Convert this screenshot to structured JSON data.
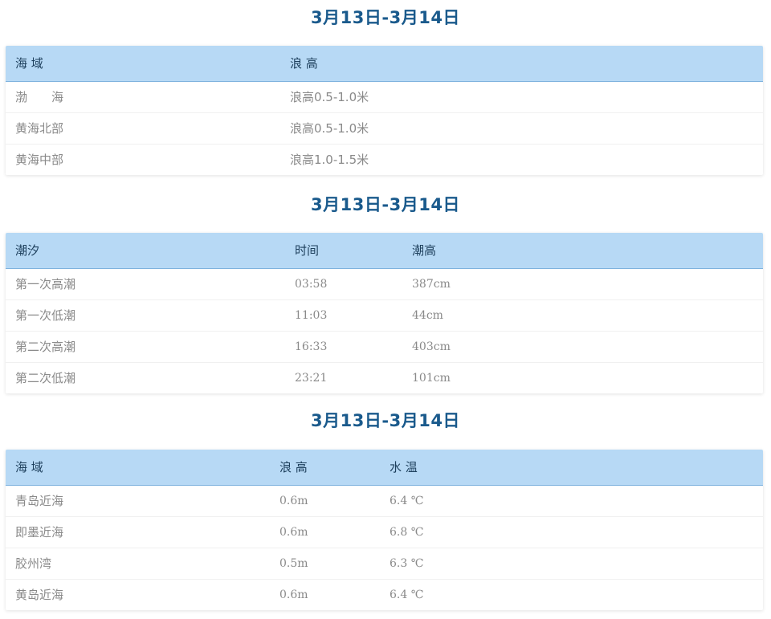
{
  "sections": [
    {
      "title": "3月13日-3月14日",
      "headers": [
        "海 域",
        "浪 高"
      ],
      "rows": [
        [
          "渤　　海",
          "浪高0.5-1.0米"
        ],
        [
          "黄海北部",
          "浪高0.5-1.0米"
        ],
        [
          "黄海中部",
          "浪高1.0-1.5米"
        ]
      ]
    },
    {
      "title": "3月13日-3月14日",
      "headers": [
        "潮汐",
        "时间",
        "潮高"
      ],
      "rows": [
        [
          "第一次高潮",
          "03:58",
          "387cm"
        ],
        [
          "第一次低潮",
          "11:03",
          "44cm"
        ],
        [
          "第二次高潮",
          "16:33",
          "403cm"
        ],
        [
          "第二次低潮",
          "23:21",
          "101cm"
        ]
      ]
    },
    {
      "title": "3月13日-3月14日",
      "headers": [
        "海 域",
        "浪 高",
        "水 温"
      ],
      "rows": [
        [
          "青岛近海",
          "0.6m",
          "6.4 ℃"
        ],
        [
          "即墨近海",
          "0.6m",
          "6.8 ℃"
        ],
        [
          "胶州湾",
          "0.5m",
          "6.3 ℃"
        ],
        [
          "黄岛近海",
          "0.6m",
          "6.4 ℃"
        ]
      ]
    }
  ]
}
